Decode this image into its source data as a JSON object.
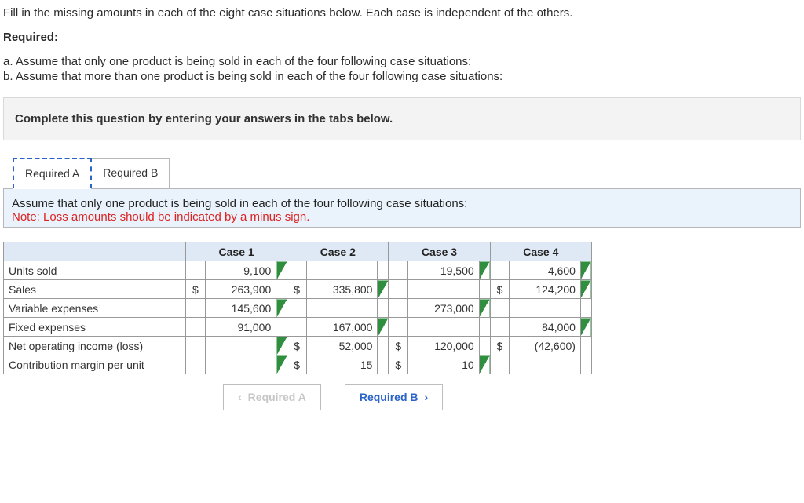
{
  "intro": {
    "lead": "Fill in the missing amounts in each of the eight case situations below. Each case is independent of the others.",
    "required_heading": "Required:",
    "req_a": "a. Assume that only one product is being sold in each of the four following case situations:",
    "req_b": "b. Assume that more than one product is being sold in each of the four following case situations:",
    "instruction": "Complete this question by entering your answers in the tabs below."
  },
  "tabs": {
    "a": "Required A",
    "b": "Required B"
  },
  "panel": {
    "line1": "Assume that only one product is being sold in each of the four following case situations:",
    "line2": "Note: Loss amounts should be indicated by a minus sign."
  },
  "headers": {
    "c1": "Case 1",
    "c2": "Case 2",
    "c3": "Case 3",
    "c4": "Case 4"
  },
  "rows": {
    "units_sold": "Units sold",
    "sales": "Sales",
    "variable": "Variable expenses",
    "fixed": "Fixed expenses",
    "noi": "Net operating income (loss)",
    "cmu": "Contribution margin per unit"
  },
  "cells": {
    "units_sold": {
      "c1": "9,100",
      "c2": "",
      "c3": "19,500",
      "c4": "4,600"
    },
    "sales": {
      "c1_sym": "$",
      "c1": "263,900",
      "c2_sym": "$",
      "c2": "335,800",
      "c3_sym": "",
      "c3": "",
      "c4_sym": "$",
      "c4": "124,200"
    },
    "variable": {
      "c1": "145,600",
      "c2": "",
      "c3": "273,000",
      "c4": ""
    },
    "fixed": {
      "c1": "91,000",
      "c2": "167,000",
      "c3": "",
      "c4": "84,000"
    },
    "noi": {
      "c1_sym": "",
      "c1": "",
      "c2_sym": "$",
      "c2": "52,000",
      "c3_sym": "$",
      "c3": "120,000",
      "c4_sym": "$",
      "c4": "(42,600)"
    },
    "cmu": {
      "c1_sym": "",
      "c1": "",
      "c2_sym": "$",
      "c2": "15",
      "c3_sym": "$",
      "c3": "10",
      "c4_sym": "",
      "c4": ""
    }
  },
  "nav": {
    "prev": "Required A",
    "next": "Required B"
  },
  "chart_data": {
    "type": "table",
    "title": "Case situations — missing amounts",
    "columns": [
      "Case 1",
      "Case 2",
      "Case 3",
      "Case 4"
    ],
    "rows": [
      {
        "label": "Units sold",
        "values": [
          9100,
          null,
          19500,
          4600
        ]
      },
      {
        "label": "Sales ($)",
        "values": [
          263900,
          335800,
          null,
          124200
        ]
      },
      {
        "label": "Variable expenses ($)",
        "values": [
          145600,
          null,
          273000,
          null
        ]
      },
      {
        "label": "Fixed expenses ($)",
        "values": [
          91000,
          167000,
          null,
          84000
        ]
      },
      {
        "label": "Net operating income (loss) ($)",
        "values": [
          null,
          52000,
          120000,
          -42600
        ]
      },
      {
        "label": "Contribution margin per unit ($)",
        "values": [
          null,
          15,
          10,
          null
        ]
      }
    ]
  }
}
